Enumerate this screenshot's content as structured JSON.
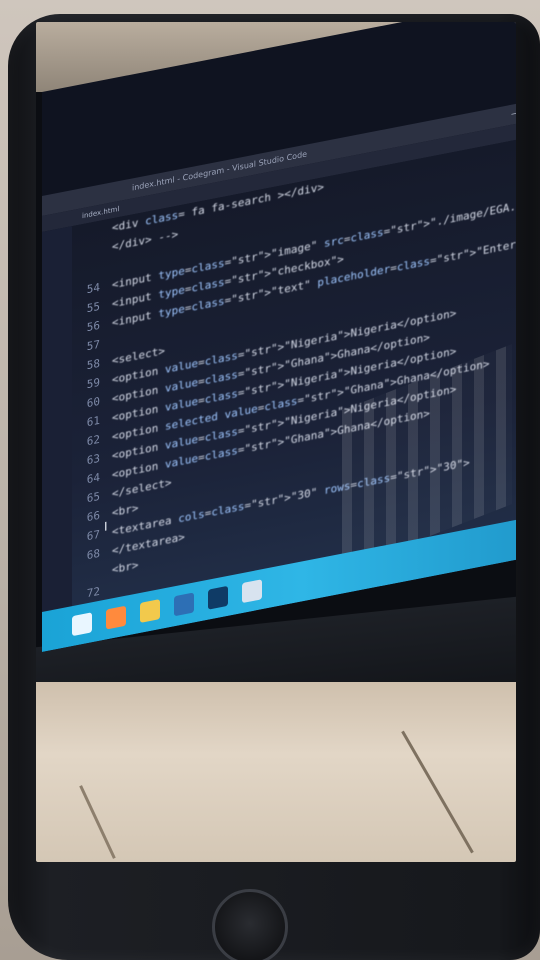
{
  "scene": {
    "description_colors": {
      "editor_bg": "#151a2a",
      "taskbar": "#2fb6e6",
      "string": "#f0c674",
      "attribute": "#9ec6ff"
    }
  },
  "editor": {
    "title": "index.html - Codegram - Visual Studio Code",
    "tab_label": "index.html",
    "line_numbers": [
      "",
      "",
      "",
      "54",
      "55",
      "56",
      "57",
      "58",
      "59",
      "60",
      "61",
      "62",
      "63",
      "64",
      "65",
      "66",
      "67",
      "68",
      "",
      "72"
    ],
    "lines": [
      "<div class= fa fa-search ></div>",
      "</div> -->",
      "",
      "<input type=\"image\" src=\"./image/EGA.jpg\">",
      "<input type=\"checkbox\">",
      "<input type=\"text\" placeholder=\"Enter your password\" readonly>",
      "",
      "<select>",
      "    <option value=\"Nigeria\">Nigeria</option>",
      "    <option value=\"Ghana\">Ghana</option>",
      "    <option value=\"Nigeria\">Nigeria</option>",
      "    <option selected value=\"Ghana\">Ghana</option>",
      "    <option value=\"Nigeria\">Nigeria</option>",
      "    <option value=\"Ghana\">Ghana</option>",
      "</select>",
      "<br>",
      "<textarea cols=\"30\" rows=\"30\">",
      "</textarea>",
      "<br>",
      ""
    ]
  },
  "icons": [
    "windows-start-icon",
    "search-icon",
    "folder-icon",
    "browser-icon",
    "vscode-icon",
    "settings-icon"
  ]
}
